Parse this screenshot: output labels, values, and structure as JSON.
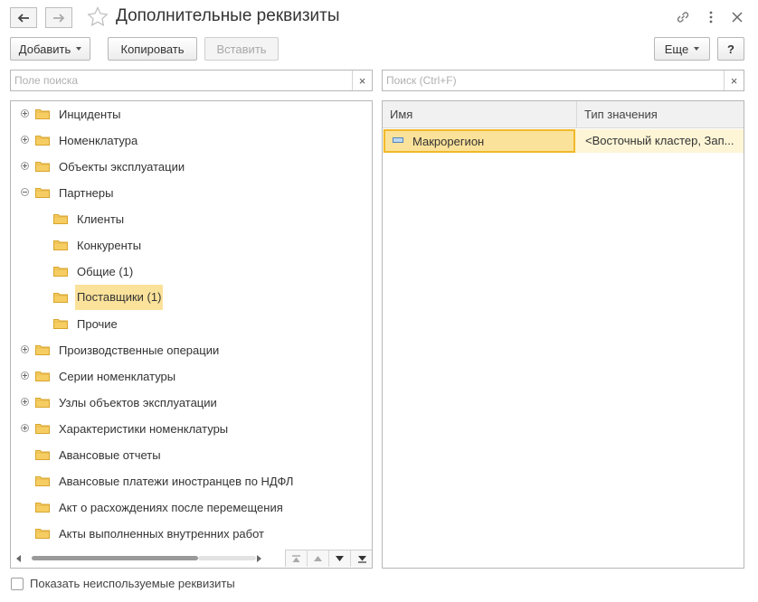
{
  "window": {
    "title": "Дополнительные реквизиты"
  },
  "toolbar": {
    "add_label": "Добавить",
    "copy_label": "Копировать",
    "paste_label": "Вставить",
    "more_label": "Еще",
    "help_label": "?"
  },
  "left_search": {
    "placeholder": "Поле поиска",
    "value": "",
    "clear_glyph": "×"
  },
  "right_search": {
    "placeholder": "Поиск (Ctrl+F)",
    "value": "",
    "clear_glyph": "×"
  },
  "tree": {
    "items": [
      {
        "label": "Инциденты",
        "expander": "plus",
        "level": 0,
        "selected": false
      },
      {
        "label": "Номенклатура",
        "expander": "plus",
        "level": 0,
        "selected": false
      },
      {
        "label": "Объекты эксплуатации",
        "expander": "plus",
        "level": 0,
        "selected": false
      },
      {
        "label": "Партнеры",
        "expander": "minus",
        "level": 0,
        "selected": false
      },
      {
        "label": "Клиенты",
        "expander": "none",
        "level": 1,
        "selected": false
      },
      {
        "label": "Конкуренты",
        "expander": "none",
        "level": 1,
        "selected": false
      },
      {
        "label": "Общие (1)",
        "expander": "none",
        "level": 1,
        "selected": false
      },
      {
        "label": "Поставщики (1)",
        "expander": "none",
        "level": 1,
        "selected": true
      },
      {
        "label": "Прочие",
        "expander": "none",
        "level": 1,
        "selected": false
      },
      {
        "label": "Производственные операции",
        "expander": "plus",
        "level": 0,
        "selected": false
      },
      {
        "label": "Серии номенклатуры",
        "expander": "plus",
        "level": 0,
        "selected": false
      },
      {
        "label": "Узлы объектов эксплуатации",
        "expander": "plus",
        "level": 0,
        "selected": false
      },
      {
        "label": "Характеристики номенклатуры",
        "expander": "plus",
        "level": 0,
        "selected": false
      },
      {
        "label": "Авансовые отчеты",
        "expander": "none",
        "level": 0,
        "selected": false
      },
      {
        "label": "Авансовые платежи иностранцев по НДФЛ",
        "expander": "none",
        "level": 0,
        "selected": false
      },
      {
        "label": "Акт о расхождениях после перемещения",
        "expander": "none",
        "level": 0,
        "selected": false
      },
      {
        "label": "Акты выполненных внутренних работ",
        "expander": "none",
        "level": 0,
        "selected": false
      }
    ]
  },
  "grid": {
    "columns": [
      "Имя",
      "Тип значения"
    ],
    "rows": [
      {
        "name": "Макрорегион",
        "type": "<Восточный кластер, Зап..."
      }
    ]
  },
  "footer": {
    "show_unused_label": "Показать неиспользуемые реквизиты",
    "show_unused_checked": false
  },
  "colors": {
    "selection": "#fbe29a",
    "selection_border": "#f0b929",
    "folder": "#f6cd62"
  }
}
